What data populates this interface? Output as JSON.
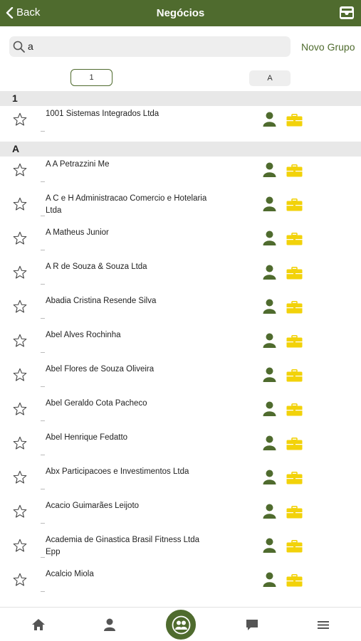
{
  "header": {
    "back_label": "Back",
    "title": "Negócios"
  },
  "search": {
    "value": "a"
  },
  "new_group_label": "Novo Grupo",
  "index_tabs": [
    "1",
    "A"
  ],
  "sections": [
    {
      "letter": "1",
      "items": [
        "1001 Sistemas Integrados Ltda"
      ]
    },
    {
      "letter": "A",
      "items": [
        "A A Petrazzini Me",
        "A C e H Administracao Comercio e Hotelaria Ltda",
        "A Matheus Junior",
        "A R de Souza & Souza Ltda",
        "Abadia Cristina Resende Silva",
        "Abel Alves Rochinha",
        "Abel Flores de Souza Oliveira",
        "Abel Geraldo Cota Pacheco",
        "Abel Henrique Fedatto",
        "Abx Participacoes e Investimentos Ltda",
        "Acacio Guimarães Leijoto",
        "Academia de Ginastica Brasil Fitness Ltda Epp",
        "Acalcio Miola"
      ]
    }
  ],
  "bottom_nav": [
    "home-icon",
    "person-icon",
    "group-icon",
    "chat-icon",
    "menu-icon"
  ],
  "colors": {
    "primary": "#4f6b2e",
    "briefcase": "#f2d20a"
  }
}
